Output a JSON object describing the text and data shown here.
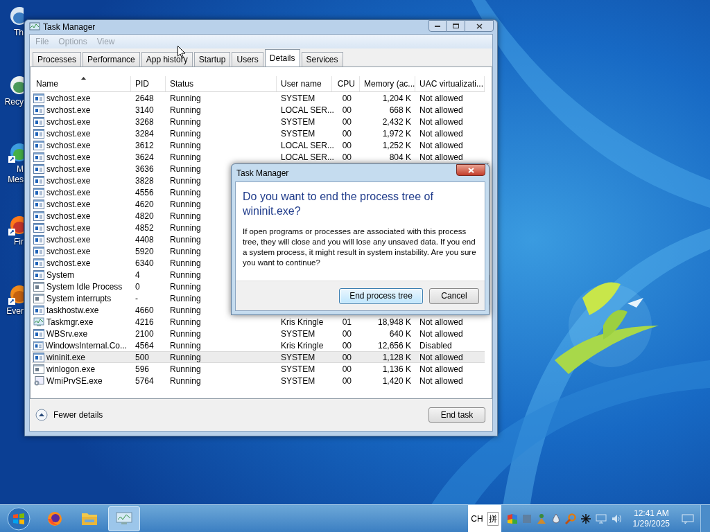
{
  "desktop_icons": [
    {
      "kind": "computer",
      "lines": [
        "Th"
      ]
    },
    {
      "kind": "recycle",
      "lines": [
        "Recy"
      ]
    },
    {
      "kind": "messenger",
      "lines": [
        "M",
        "Mes"
      ]
    },
    {
      "kind": "firefox",
      "lines": [
        "Fir"
      ]
    },
    {
      "kind": "evernote",
      "lines": [
        "Ever"
      ]
    }
  ],
  "window": {
    "title": "Task Manager",
    "menu": [
      {
        "label": "File",
        "disabled": true
      },
      {
        "label": "Options",
        "disabled": true
      },
      {
        "label": "View",
        "disabled": true
      }
    ],
    "tabs": [
      {
        "label": "Processes",
        "selected": false
      },
      {
        "label": "Performance",
        "selected": false
      },
      {
        "label": "App history",
        "selected": false
      },
      {
        "label": "Startup",
        "selected": false
      },
      {
        "label": "Users",
        "selected": false
      },
      {
        "label": "Details",
        "selected": true
      },
      {
        "label": "Services",
        "selected": false
      }
    ],
    "columns": [
      {
        "label": "Name",
        "sorted": true
      },
      {
        "label": "PID",
        "sorted": false
      },
      {
        "label": "Status",
        "sorted": false
      },
      {
        "label": "User name",
        "sorted": false
      },
      {
        "label": "CPU",
        "sorted": false
      },
      {
        "label": "Memory (ac...",
        "sorted": false
      },
      {
        "label": "UAC virtualizati...",
        "sorted": false
      }
    ],
    "rows": [
      {
        "kind": "service",
        "name": "svchost.exe",
        "pid": "2648",
        "status": "Running",
        "user": "SYSTEM",
        "cpu": "00",
        "memory": "1,204 K",
        "uac": "Not allowed",
        "selected": false
      },
      {
        "kind": "service",
        "name": "svchost.exe",
        "pid": "3140",
        "status": "Running",
        "user": "LOCAL SER...",
        "cpu": "00",
        "memory": "668 K",
        "uac": "Not allowed",
        "selected": false
      },
      {
        "kind": "service",
        "name": "svchost.exe",
        "pid": "3268",
        "status": "Running",
        "user": "SYSTEM",
        "cpu": "00",
        "memory": "2,432 K",
        "uac": "Not allowed",
        "selected": false
      },
      {
        "kind": "service",
        "name": "svchost.exe",
        "pid": "3284",
        "status": "Running",
        "user": "SYSTEM",
        "cpu": "00",
        "memory": "1,972 K",
        "uac": "Not allowed",
        "selected": false
      },
      {
        "kind": "service",
        "name": "svchost.exe",
        "pid": "3612",
        "status": "Running",
        "user": "LOCAL SER...",
        "cpu": "00",
        "memory": "1,252 K",
        "uac": "Not allowed",
        "selected": false
      },
      {
        "kind": "service",
        "name": "svchost.exe",
        "pid": "3624",
        "status": "Running",
        "user": "LOCAL SER...",
        "cpu": "00",
        "memory": "804 K",
        "uac": "Not allowed",
        "selected": false
      },
      {
        "kind": "service",
        "name": "svchost.exe",
        "pid": "3636",
        "status": "Running",
        "selected": false
      },
      {
        "kind": "service",
        "name": "svchost.exe",
        "pid": "3828",
        "status": "Running",
        "selected": false
      },
      {
        "kind": "service",
        "name": "svchost.exe",
        "pid": "4556",
        "status": "Running",
        "selected": false
      },
      {
        "kind": "service",
        "name": "svchost.exe",
        "pid": "4620",
        "status": "Running",
        "selected": false
      },
      {
        "kind": "service",
        "name": "svchost.exe",
        "pid": "4820",
        "status": "Running",
        "selected": false
      },
      {
        "kind": "service",
        "name": "svchost.exe",
        "pid": "4852",
        "status": "Running",
        "selected": false
      },
      {
        "kind": "service",
        "name": "svchost.exe",
        "pid": "4408",
        "status": "Running",
        "selected": false
      },
      {
        "kind": "service",
        "name": "svchost.exe",
        "pid": "5920",
        "status": "Running",
        "selected": false
      },
      {
        "kind": "service",
        "name": "svchost.exe",
        "pid": "6340",
        "status": "Running",
        "selected": false
      },
      {
        "kind": "service",
        "name": "System",
        "pid": "4",
        "status": "Running",
        "selected": false
      },
      {
        "kind": "plain",
        "name": "System Idle Process",
        "pid": "0",
        "status": "Running",
        "selected": false
      },
      {
        "kind": "plain",
        "name": "System interrupts",
        "pid": "-",
        "status": "Running",
        "selected": false
      },
      {
        "kind": "service",
        "name": "taskhostw.exe",
        "pid": "4660",
        "status": "Running",
        "selected": false
      },
      {
        "kind": "taskmgr",
        "name": "Taskmgr.exe",
        "pid": "4216",
        "status": "Running",
        "user": "Kris Kringle",
        "cpu": "01",
        "memory": "18,948 K",
        "uac": "Not allowed",
        "selected": false
      },
      {
        "kind": "service",
        "name": "WBSrv.exe",
        "pid": "2100",
        "status": "Running",
        "user": "SYSTEM",
        "cpu": "00",
        "memory": "640 K",
        "uac": "Not allowed",
        "selected": false
      },
      {
        "kind": "service",
        "name": "WindowsInternal.Co...",
        "pid": "4564",
        "status": "Running",
        "user": "Kris Kringle",
        "cpu": "00",
        "memory": "12,656 K",
        "uac": "Disabled",
        "selected": false
      },
      {
        "kind": "service",
        "name": "wininit.exe",
        "pid": "500",
        "status": "Running",
        "user": "SYSTEM",
        "cpu": "00",
        "memory": "1,128 K",
        "uac": "Not allowed",
        "selected": true
      },
      {
        "kind": "plain",
        "name": "winlogon.exe",
        "pid": "596",
        "status": "Running",
        "user": "SYSTEM",
        "cpu": "00",
        "memory": "1,136 K",
        "uac": "Not allowed",
        "selected": false
      },
      {
        "kind": "wmi",
        "name": "WmiPrvSE.exe",
        "pid": "5764",
        "status": "Running",
        "user": "SYSTEM",
        "cpu": "00",
        "memory": "1,420 K",
        "uac": "Not allowed",
        "selected": false
      }
    ],
    "fewer_details": "Fewer details",
    "end_task": "End task"
  },
  "dialog": {
    "title": "Task Manager",
    "heading": "Do you want to end the process tree of wininit.exe?",
    "body": "If open programs or processes are associated with this process tree, they will close and you will lose any unsaved data. If you end a system process, it might result in system instability. Are you sure you want to continue?",
    "buttons": [
      {
        "label": "End process tree",
        "default": true
      },
      {
        "label": "Cancel",
        "default": false
      }
    ]
  },
  "taskbar": {
    "apps": [
      {
        "kind": "firefox",
        "active": false
      },
      {
        "kind": "folder",
        "active": false
      },
      {
        "kind": "taskmgr",
        "active": true
      }
    ],
    "language": "CH",
    "ime": "拼",
    "tray": [
      {
        "kind": "flag"
      },
      {
        "kind": "square"
      },
      {
        "kind": "people"
      },
      {
        "kind": "drop"
      },
      {
        "kind": "magnifier"
      },
      {
        "kind": "snowflake"
      },
      {
        "kind": "monitor"
      },
      {
        "kind": "speaker"
      }
    ],
    "time": "12:41 AM",
    "date": "1/29/2025"
  }
}
